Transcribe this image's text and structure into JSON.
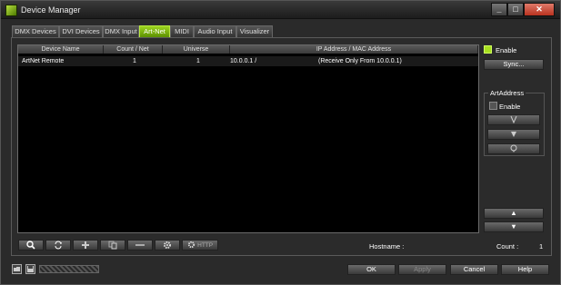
{
  "window": {
    "title": "Device Manager",
    "minimize": "_",
    "maximize": "□",
    "close": "✕"
  },
  "tabs": [
    {
      "label": "DMX Devices"
    },
    {
      "label": "DVI Devices"
    },
    {
      "label": "DMX Input"
    },
    {
      "label": "Art-Net",
      "active": true
    },
    {
      "label": "MIDI"
    },
    {
      "label": "Audio Input"
    },
    {
      "label": "Visualizer"
    }
  ],
  "table": {
    "columns": [
      "Device Name",
      "Count / Net",
      "Universe",
      "IP Address / MAC Address"
    ],
    "rows": [
      {
        "name": "ArtNet Remote",
        "count": "1",
        "universe": "1",
        "ip": "10.0.0.1 /",
        "mac": "(Receive Only From 10.0.0.1)"
      }
    ]
  },
  "right_panel": {
    "enable_label": "Enable",
    "sync_label": "Sync...",
    "artaddress_title": "ArtAddress",
    "artaddress_enable_label": "Enable",
    "up_arrow": "▲",
    "down_arrow": "▼"
  },
  "toolbar_icons": [
    "search-icon",
    "refresh-icon",
    "add-icon",
    "copy-icon",
    "remove-icon",
    "settings-icon",
    "http-settings-icon"
  ],
  "toolbar": {
    "http_label": "HTTP"
  },
  "status": {
    "hostname_label": "Hostname :",
    "count_label": "Count :",
    "count_value": "1"
  },
  "footer": {
    "ok": "OK",
    "apply": "Apply",
    "cancel": "Cancel",
    "help": "Help"
  },
  "colors": {
    "accent": "#8cc63f",
    "background": "#2b2b2b"
  }
}
